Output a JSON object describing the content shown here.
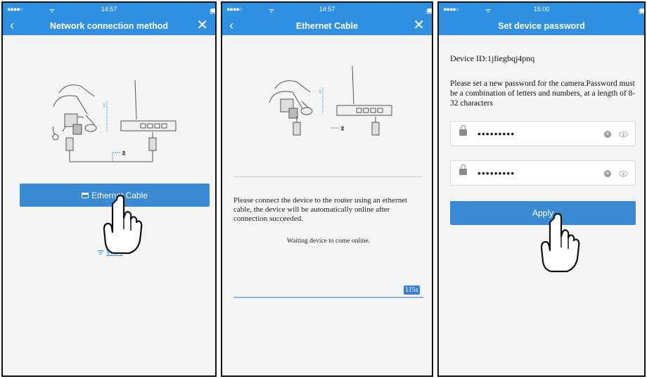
{
  "screens": [
    {
      "status": {
        "signal": "●●●●○",
        "time": "14:57",
        "battery": "59%"
      },
      "title": "Network connection method",
      "back_icon": "chevron-left-icon",
      "close_icon": "close-icon",
      "options": {
        "ethernet": "Ethernet Cable",
        "wifi": "WIFI"
      },
      "diagram_labels": {
        "one": "1",
        "two": "2"
      }
    },
    {
      "status": {
        "signal": "●●●●○",
        "time": "14:57",
        "battery": "59%"
      },
      "title": "Ethernet Cable",
      "back_icon": "chevron-left-icon",
      "close_icon": "close-icon",
      "instruction": "Please connect the device to the router using an ethernet cable, the device will be automatically online after connection succeeded.",
      "waiting": "Waiting device to come online.",
      "countdown": "115s",
      "diagram_labels": {
        "one": "1",
        "two": "2"
      }
    },
    {
      "status": {
        "signal": "●●●●○",
        "time": "15:00",
        "battery": "59%"
      },
      "title": "Set device password",
      "device_id": "Device ID:1jfiegbqj4pnq",
      "description": "Please set a new password for the camera.Password must be a combination of letters and numbers, at a length of 8-32 characters",
      "password": "•••••••••",
      "confirm_password": "•••••••••",
      "apply": "Apply"
    }
  ],
  "colors": {
    "header": "#2f8fe0",
    "button": "#3a8ad4",
    "background": "#f4f4f4"
  }
}
